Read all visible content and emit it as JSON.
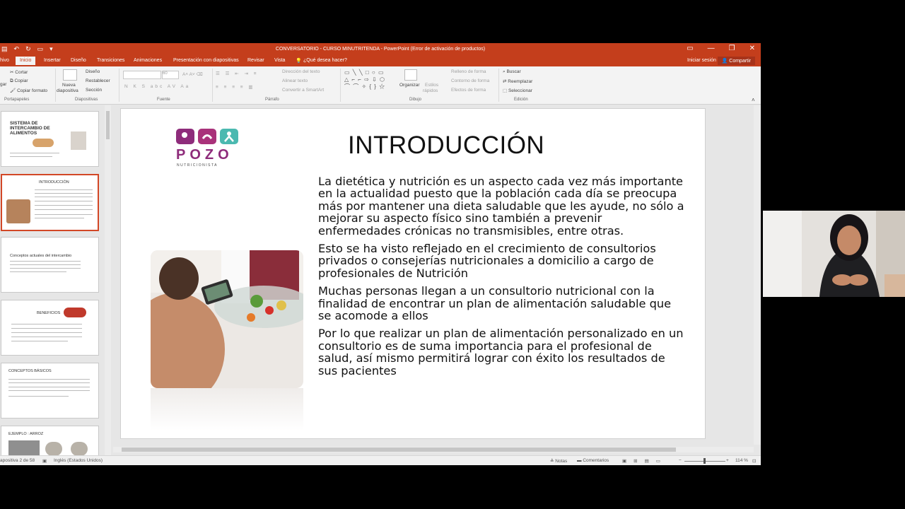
{
  "titlebar": {
    "document_title": "CONVERSATORIO - CURSO MINUTRITENDA - PowerPoint (Error de activación de productos)",
    "window_controls": [
      "▭",
      "—",
      "❐",
      "✕"
    ]
  },
  "tabs": {
    "items": [
      "hivo",
      "Inicio",
      "Insertar",
      "Diseño",
      "Transiciones",
      "Animaciones",
      "Presentación con diapositivas",
      "Revisar",
      "Vista"
    ],
    "active": "Inicio",
    "tell_me": "¿Qué desea hacer?",
    "sign_in": "Iniciar sesión",
    "share": "Compartir"
  },
  "ribbon": {
    "clipboard": {
      "cut": "Cortar",
      "copy": "Copiar",
      "format_painter": "Copiar formato",
      "paste_partial": "gar",
      "group": "Portapapeles"
    },
    "slides": {
      "new_slide_1": "Nueva",
      "new_slide_2": "diapositiva",
      "layout": "Diseño",
      "reset": "Restablecer",
      "section": "Sección",
      "group": "Diapositivas"
    },
    "font": {
      "font_size": "60",
      "group": "Fuente",
      "formats": "N K S abc AV Aa"
    },
    "paragraph": {
      "text_direction": "Dirección del texto",
      "align_text": "Alinear texto",
      "smartart": "Convertir a SmartArt",
      "group": "Párrafo"
    },
    "drawing": {
      "arrange": "Organizar",
      "quick_styles_1": "Estilos",
      "quick_styles_2": "rápidos",
      "shape_fill": "Relleno de forma",
      "shape_outline": "Contorno de forma",
      "shape_effects": "Efectos de forma",
      "group": "Dibujo"
    },
    "editing": {
      "find": "Buscar",
      "replace": "Reemplazar",
      "select": "Seleccionar",
      "group": "Edición"
    }
  },
  "thumbnails": [
    {
      "title": "SISTEMA DE INTERCAMBIO DE ALIMENTOS"
    },
    {
      "title": "INTRODUCCIÓN"
    },
    {
      "title": "Conceptos actuales del intercambio"
    },
    {
      "title": "BENEFICIOS"
    },
    {
      "title": "CONCEPTOS BÁSICOS"
    },
    {
      "title": "EJEMPLO : ARROZ"
    }
  ],
  "slide": {
    "title": "INTRODUCCIÓN",
    "logo_text": "POZO",
    "logo_subtext": "NUTRICIONISTA",
    "paragraphs": [
      "La dietética y nutrición es un aspecto cada vez más importante en la actualidad puesto que la población cada día se preocupa más por mantener una dieta saludable que les ayude, no sólo a mejorar su aspecto físico sino también a prevenir enfermedades crónicas no transmisibles, entre otras.",
      "Esto se ha visto reflejado en el crecimiento de consultorios privados o consejerías nutricionales a domicilio a cargo de profesionales de Nutrición",
      "Muchas personas llegan a un consultorio nutricional con la finalidad de encontrar un plan de alimentación saludable que se acomode a ellos",
      "Por lo que realizar un plan de alimentación personalizado en un consultorio es de suma importancia para el profesional de salud, así mismo permitirá lograr con éxito los resultados de sus pacientes"
    ]
  },
  "status": {
    "slide_count": "apositiva 2 de 58",
    "language": "Inglés (Estados Unidos)",
    "notes": "Notas",
    "comments": "Comentarios",
    "zoom": "114 %"
  },
  "colors": {
    "accent": "#c43e1c",
    "logo_magenta": "#8e2c7b",
    "logo_teal": "#4bb9b0"
  }
}
